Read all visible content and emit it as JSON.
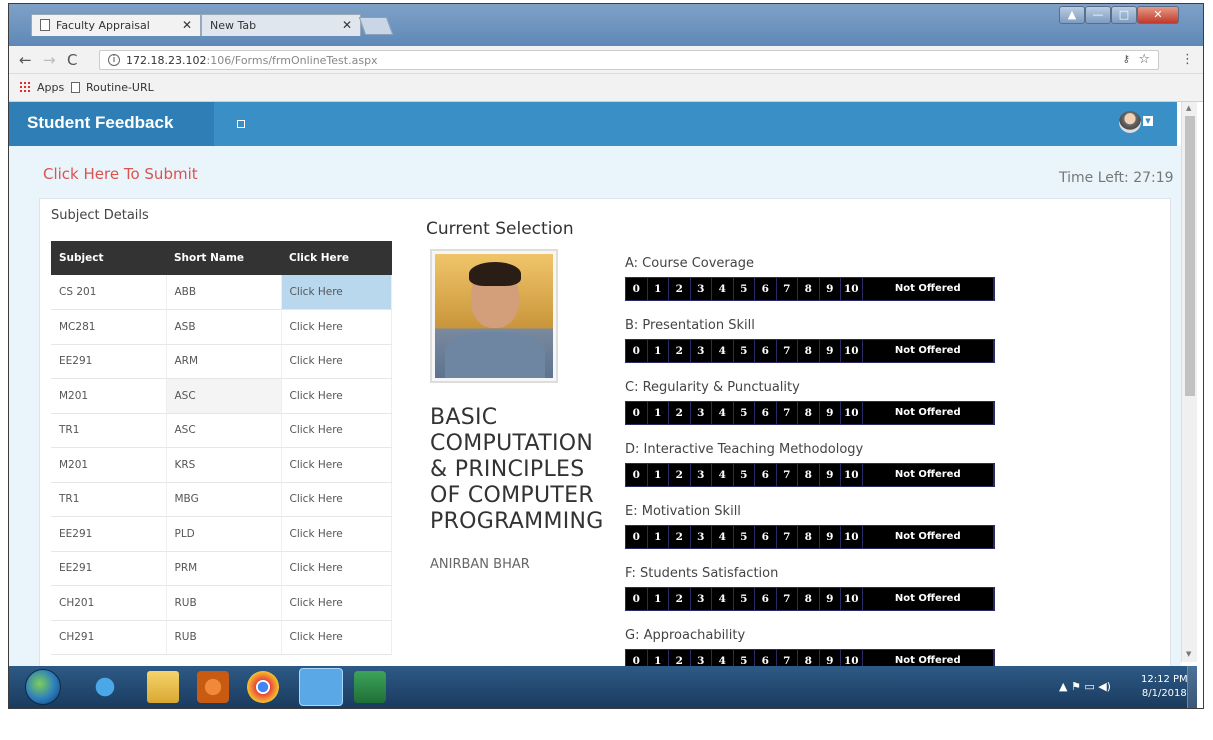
{
  "browser": {
    "tabs": [
      {
        "label": "Faculty Appraisal",
        "active": true
      },
      {
        "label": "New Tab",
        "active": false
      }
    ],
    "url_host": "172.18.23.102",
    "url_path": ":106/Forms/frmOnlineTest.aspx",
    "bookmarks": [
      "Apps",
      "Routine-URL"
    ]
  },
  "app": {
    "brand": "Student Feedback",
    "submit_link": "Click Here To Submit",
    "time_left": "Time Left: 27:19",
    "subject_details_title": "Subject Details",
    "table_headers": [
      "Subject",
      "Short Name",
      "Click Here"
    ],
    "subjects": [
      {
        "subject": "CS 201",
        "short": "ABB",
        "action": "Click Here"
      },
      {
        "subject": "MC281",
        "short": "ASB",
        "action": "Click Here"
      },
      {
        "subject": "EE291",
        "short": "ARM",
        "action": "Click Here"
      },
      {
        "subject": "M201",
        "short": "ASC",
        "action": "Click Here"
      },
      {
        "subject": "TR1",
        "short": "ASC",
        "action": "Click Here"
      },
      {
        "subject": "M201",
        "short": "KRS",
        "action": "Click Here"
      },
      {
        "subject": "TR1",
        "short": "MBG",
        "action": "Click Here"
      },
      {
        "subject": "EE291",
        "short": "PLD",
        "action": "Click Here"
      },
      {
        "subject": "EE291",
        "short": "PRM",
        "action": "Click Here"
      },
      {
        "subject": "CH201",
        "short": "RUB",
        "action": "Click Here"
      },
      {
        "subject": "CH291",
        "short": "RUB",
        "action": "Click Here"
      }
    ],
    "current_selection_title": "Current Selection",
    "course_name": "BASIC COMPUTATION & PRINCIPLES OF COMPUTER PROGRAMMING",
    "faculty_name": "ANIRBAN BHAR",
    "criteria": [
      "A: Course Coverage",
      "B: Presentation Skill",
      "C: Regularity & Punctuality",
      "D: Interactive Teaching Methodology",
      "E: Motivation Skill",
      "F: Students Satisfaction",
      "G: Approachability"
    ],
    "scale": [
      "0",
      "1",
      "2",
      "3",
      "4",
      "5",
      "6",
      "7",
      "8",
      "9",
      "10",
      "Not Offered"
    ]
  },
  "taskbar": {
    "time": "12:12 PM",
    "date": "8/1/2018"
  },
  "colors": {
    "header_blue": "#3a8fc7",
    "submit_red": "#d9534f",
    "selected_row": "#b9d8ee",
    "scale_bg": "#000000"
  },
  "icons": [
    "page-icon",
    "close-icon",
    "back-icon",
    "forward-icon",
    "reload-icon",
    "info-icon",
    "key-icon",
    "star-icon",
    "menu-icon",
    "apps-icon",
    "avatar-icon",
    "start-orb-icon",
    "ie-icon",
    "folder-icon",
    "media-icon",
    "chrome-icon",
    "teamviewer-icon",
    "excel-icon"
  ]
}
